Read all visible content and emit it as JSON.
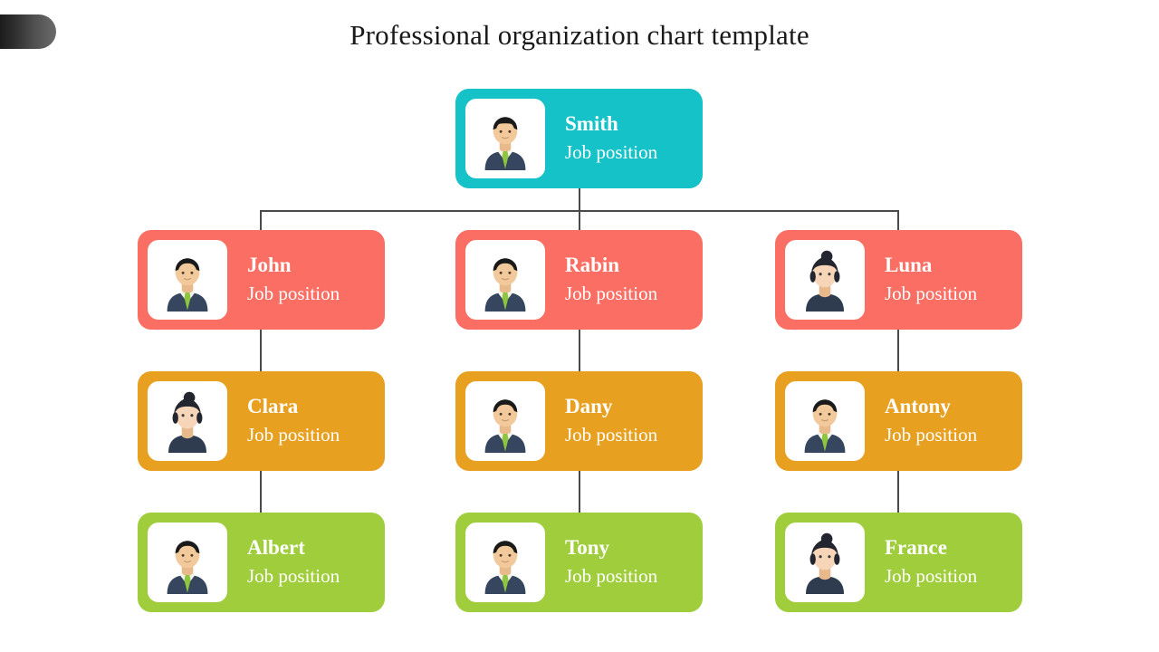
{
  "slide": {
    "title": "Professional organization chart template",
    "background_color": "#ffffff",
    "corner_tab": {
      "name": "corner-tab",
      "gradient_from": "#1c1c1c",
      "gradient_to": "#6b6b6b"
    }
  },
  "palette": {
    "teal": "#14C2C8",
    "coral": "#FA6E64",
    "orange": "#E8A020",
    "green": "#A0CD3C",
    "connector": "#4a4a4a",
    "card_text": "#ffffff",
    "avatar_box": "#ffffff",
    "title_text": "#1a1a1a"
  },
  "chart_data": {
    "type": "org-chart",
    "title": "Professional organization chart template",
    "levels": 4,
    "columns": 3,
    "nodes": [
      {
        "id": "smith",
        "name": "Smith",
        "position": "Job position",
        "level": 0,
        "column": 1,
        "gender": "male",
        "color": "#14C2C8",
        "parent": null
      },
      {
        "id": "john",
        "name": "John",
        "position": "Job position",
        "level": 1,
        "column": 0,
        "gender": "male",
        "color": "#FA6E64",
        "parent": "smith"
      },
      {
        "id": "rabin",
        "name": "Rabin",
        "position": "Job position",
        "level": 1,
        "column": 1,
        "gender": "male",
        "color": "#FA6E64",
        "parent": "smith"
      },
      {
        "id": "luna",
        "name": "Luna",
        "position": "Job position",
        "level": 1,
        "column": 2,
        "gender": "female",
        "color": "#FA6E64",
        "parent": "smith"
      },
      {
        "id": "clara",
        "name": "Clara",
        "position": "Job position",
        "level": 2,
        "column": 0,
        "gender": "female",
        "color": "#E8A020",
        "parent": "john"
      },
      {
        "id": "dany",
        "name": "Dany",
        "position": "Job position",
        "level": 2,
        "column": 1,
        "gender": "male",
        "color": "#E8A020",
        "parent": "rabin"
      },
      {
        "id": "antony",
        "name": "Antony",
        "position": "Job position",
        "level": 2,
        "column": 2,
        "gender": "male",
        "color": "#E8A020",
        "parent": "luna"
      },
      {
        "id": "albert",
        "name": "Albert",
        "position": "Job position",
        "level": 3,
        "column": 0,
        "gender": "male",
        "color": "#A0CD3C",
        "parent": "clara"
      },
      {
        "id": "tony",
        "name": "Tony",
        "position": "Job position",
        "level": 3,
        "column": 1,
        "gender": "male",
        "color": "#A0CD3C",
        "parent": "dany"
      },
      {
        "id": "france",
        "name": "France",
        "position": "Job position",
        "level": 3,
        "column": 2,
        "gender": "female",
        "color": "#A0CD3C",
        "parent": "antony"
      }
    ]
  },
  "nodes": {
    "smith": {
      "name": "Smith",
      "position": "Job position",
      "avatar": "avatar-male-icon"
    },
    "john": {
      "name": "John",
      "position": "Job position",
      "avatar": "avatar-male-icon"
    },
    "rabin": {
      "name": "Rabin",
      "position": "Job position",
      "avatar": "avatar-male-icon"
    },
    "luna": {
      "name": "Luna",
      "position": "Job position",
      "avatar": "avatar-female-icon"
    },
    "clara": {
      "name": "Clara",
      "position": "Job position",
      "avatar": "avatar-female-icon"
    },
    "dany": {
      "name": "Dany",
      "position": "Job position",
      "avatar": "avatar-male-icon"
    },
    "antony": {
      "name": "Antony",
      "position": "Job position",
      "avatar": "avatar-male-icon"
    },
    "albert": {
      "name": "Albert",
      "position": "Job position",
      "avatar": "avatar-male-icon"
    },
    "tony": {
      "name": "Tony",
      "position": "Job position",
      "avatar": "avatar-male-icon"
    },
    "france": {
      "name": "France",
      "position": "Job position",
      "avatar": "avatar-female-icon"
    }
  }
}
